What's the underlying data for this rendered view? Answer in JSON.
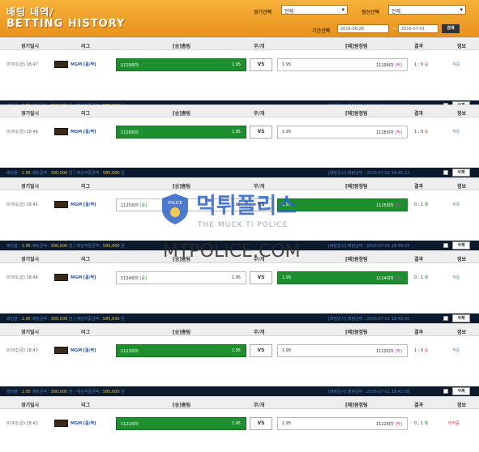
{
  "header": {
    "title_ko": "배팅 내역/",
    "title_en": "BETTING HISTORY",
    "game_filter_label": "경기선택",
    "game_filter_value": "전체",
    "settle_filter_label": "정산선택",
    "settle_filter_value": "전체",
    "period_label": "기간선택",
    "date_from": "2016-06-28",
    "date_sep": "~",
    "date_to": "2016-07-01",
    "search_label": "검색"
  },
  "columns": {
    "date": "경기일시",
    "league": "리그",
    "home": "[승]홈팀",
    "draw": "무/개",
    "away": "[패]원정팀",
    "result": "결과",
    "status": "정보"
  },
  "bets": [
    {
      "date": "07/01(금) 18:47",
      "league": "MGM [홀/짝]",
      "home_name": "1129회차",
      "home_tag": "",
      "home_odds": "1.95",
      "home_win": true,
      "vs": "VS",
      "away_odds": "1.95",
      "away_name": "1129회차",
      "away_tag": "[짝]",
      "away_win": false,
      "result_score": "1 : 0",
      "result_mark": "승",
      "status": "적중",
      "info_prefix": "배당율 : ",
      "info_odds": "1.95",
      "info_bet_label": " 배팅금액 : ",
      "info_bet": "300,000",
      "info_win_label": " 원 / 예상적중금액 : ",
      "info_win": "585,000",
      "info_unit": " 원",
      "bet_time": "[배팅일시] 배팅날짜 : 2016-07-01 18:46:40",
      "delete_label": "삭제"
    },
    {
      "date": "07/01(금) 18:46",
      "league": "MGM [홀/짝]",
      "home_name": "1128회차",
      "home_tag": "",
      "home_odds": "1.95",
      "home_win": true,
      "vs": "VS",
      "away_odds": "1.95",
      "away_name": "1128회차",
      "away_tag": "[짝]",
      "away_win": false,
      "result_score": "1 : 0",
      "result_mark": "승",
      "status": "적중",
      "info_prefix": "배당율 : ",
      "info_odds": "1.95",
      "info_bet_label": " 배팅금액 : ",
      "info_bet": "300,000",
      "info_win_label": " 원 / 예상적중금액 : ",
      "info_win": "585,000",
      "info_unit": " 원",
      "bet_time": "[배팅일시] 배팅날짜 : 2016-07-01 18:45:22",
      "delete_label": "삭제"
    },
    {
      "date": "07/01(금) 18:45",
      "league": "MGM [홀/짝]",
      "home_name": "1125회차",
      "home_tag": "[홀]",
      "home_odds": "1.95",
      "home_win": false,
      "vs": "VS",
      "away_odds": "1.95",
      "away_name": "1125회차",
      "away_tag": "[짝]",
      "away_win": true,
      "result_score": "0 : 1",
      "result_mark": "패",
      "status": "적중",
      "info_prefix": "배당율 : ",
      "info_odds": "1.95",
      "info_bet_label": " 배팅금액 : ",
      "info_bet": "300,000",
      "info_win_label": " 원 / 예상적중금액 : ",
      "info_win": "585,000",
      "info_unit": " 원",
      "bet_time": "[배팅일시] 배팅날짜 : 2016-07-01 18:44:24",
      "delete_label": "삭제"
    },
    {
      "date": "07/01(금) 18:44",
      "league": "MGM [홀/짝]",
      "home_name": "1124회차",
      "home_tag": "[홀]",
      "home_odds": "1.95",
      "home_win": false,
      "vs": "VS",
      "away_odds": "1.95",
      "away_name": "1124회차",
      "away_tag": "[짝]",
      "away_win": true,
      "result_score": "0 : 1",
      "result_mark": "패",
      "status": "적중",
      "info_prefix": "배당율 : ",
      "info_odds": "1.95",
      "info_bet_label": " 배팅금액 : ",
      "info_bet": "300,000",
      "info_win_label": " 원 / 예상적중금액 : ",
      "info_win": "585,000",
      "info_unit": " 원",
      "bet_time": "[배팅일시] 배팅날짜 : 2016-07-01 18:43:06",
      "delete_label": "삭제"
    },
    {
      "date": "07/01(금) 18:43",
      "league": "MGM [홀/짝]",
      "home_name": "1123회차",
      "home_tag": "",
      "home_odds": "1.95",
      "home_win": true,
      "vs": "VS",
      "away_odds": "1.95",
      "away_name": "1123회차",
      "away_tag": "[짝]",
      "away_win": false,
      "result_score": "1 : 0",
      "result_mark": "승",
      "status": "적중",
      "info_prefix": "배당율 : ",
      "info_odds": "1.95",
      "info_bet_label": " 배팅금액 : ",
      "info_bet": "300,000",
      "info_win_label": " 원 / 예상적중금액 : ",
      "info_win": "585,000",
      "info_unit": " 원",
      "bet_time": "[배팅일시] 배팅날짜 : 2016-07-01 18:42:08",
      "delete_label": "삭제"
    },
    {
      "date": "07/01(금) 18:42",
      "league": "MGM [홀/짝]",
      "home_name": "1122회차",
      "home_tag": "",
      "home_odds": "1.95",
      "home_win": true,
      "vs": "VS",
      "away_odds": "1.95",
      "away_name": "1122회차",
      "away_tag": "[짝]",
      "away_win": false,
      "result_score": "0 : 1",
      "result_mark": "패",
      "status": "미적중",
      "info_prefix": "배당율 : ",
      "info_odds": "1.95",
      "info_bet_label": " 배팅금액 : ",
      "info_bet": "300,000",
      "info_win_label": " 원 / 예상적중금액 : ",
      "info_win": "585,000",
      "info_unit": " 원",
      "bet_time": "[배팅일시] 배팅날짜 : 2016-07-01 18:41:10",
      "delete_label": "삭제"
    }
  ],
  "watermark": {
    "logo_text": "POLICE",
    "name_ko": "먹튀폴리스",
    "name_en": "THE MUCK TI POLICE",
    "url": "MTPOLICE.COM"
  },
  "colors": {
    "header_orange": "#f0a22c",
    "win_green": "#1d8f2e",
    "bar_navy": "#0c1a2e",
    "link_blue": "#2b5aa8",
    "hit_blue": "#4a8ad6",
    "miss_red": "#d43b2f"
  }
}
